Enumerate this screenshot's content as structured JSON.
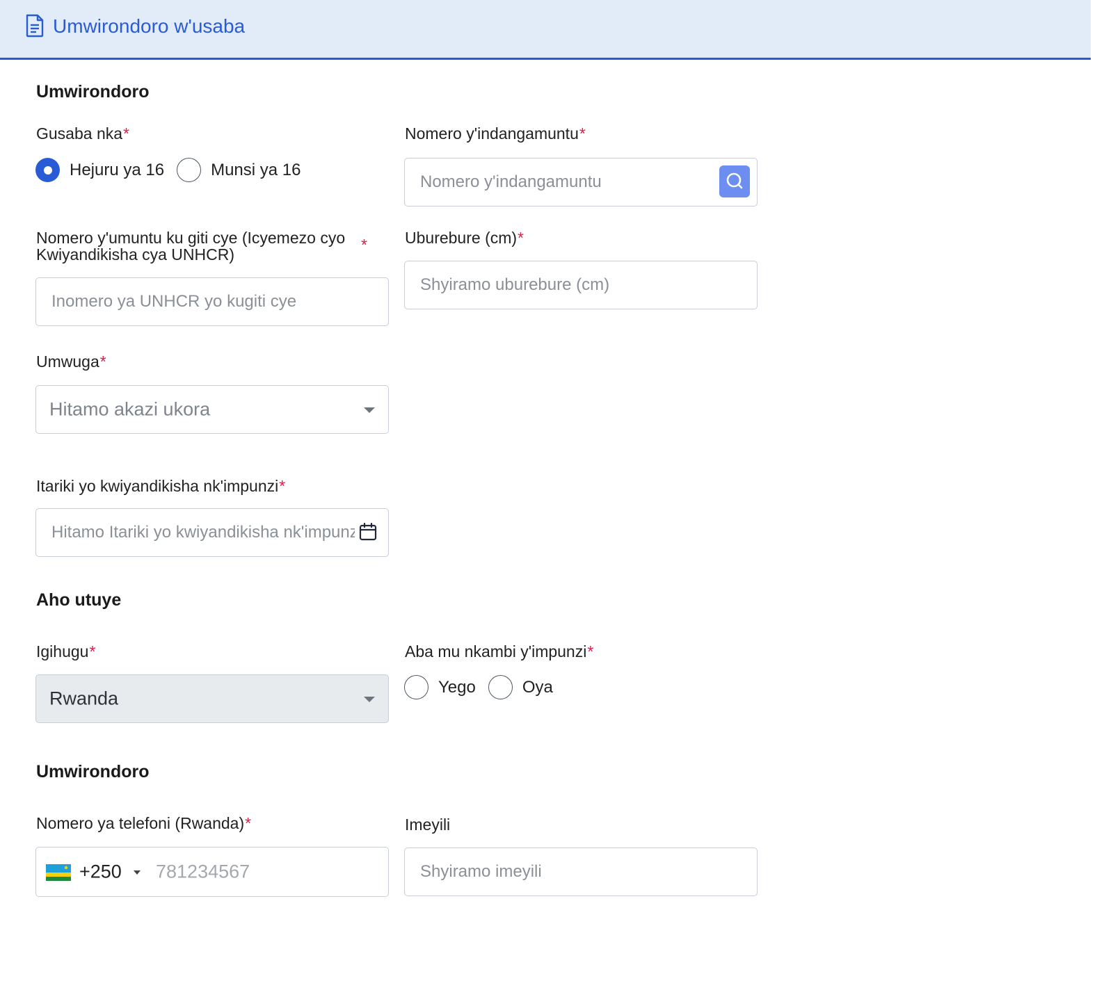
{
  "header": {
    "title": "Umwirondoro w'usaba",
    "icon": "document-icon"
  },
  "section_profile": {
    "title": "Umwirondoro"
  },
  "apply_as": {
    "label": "Gusaba nka",
    "options": [
      {
        "label": "Hejuru ya 16",
        "selected": true
      },
      {
        "label": "Munsi ya 16",
        "selected": false
      }
    ]
  },
  "national_id": {
    "label": "Nomero y'indangamuntu",
    "placeholder": "Nomero y'indangamuntu",
    "search_icon": "search-icon"
  },
  "unhcr": {
    "label": "Nomero y'umuntu ku giti cye (Icyemezo cyo Kwiyandikisha cya UNHCR)",
    "placeholder": "Inomero ya UNHCR yo kugiti cye"
  },
  "height": {
    "label": "Uburebure (cm)",
    "placeholder": "Shyiramo uburebure (cm)"
  },
  "occupation": {
    "label": "Umwuga",
    "placeholder": "Hitamo akazi ukora"
  },
  "registration_date": {
    "label": "Itariki yo kwiyandikisha nk'impunzi",
    "placeholder": "Hitamo Itariki yo kwiyandikisha nk'impunzi",
    "icon": "calendar-icon"
  },
  "section_residence": {
    "title": "Aho utuye"
  },
  "country": {
    "label": "Igihugu",
    "value": "Rwanda"
  },
  "refugee_camp": {
    "label": "Aba mu nkambi y'impunzi",
    "options": [
      {
        "label": "Yego",
        "selected": false
      },
      {
        "label": "Oya",
        "selected": false
      }
    ]
  },
  "section_contact": {
    "title": "Umwirondoro"
  },
  "phone": {
    "label": "Nomero ya telefoni (Rwanda)",
    "dial_code": "+250",
    "placeholder": "781234567",
    "flag": "rwanda-flag-icon"
  },
  "email": {
    "label": "Imeyili",
    "placeholder": "Shyiramo imeyili"
  },
  "required_marker": "*",
  "colors": {
    "accent": "#2a5bd7",
    "header_bg": "#e1ecf8",
    "required": "#e11d48"
  }
}
